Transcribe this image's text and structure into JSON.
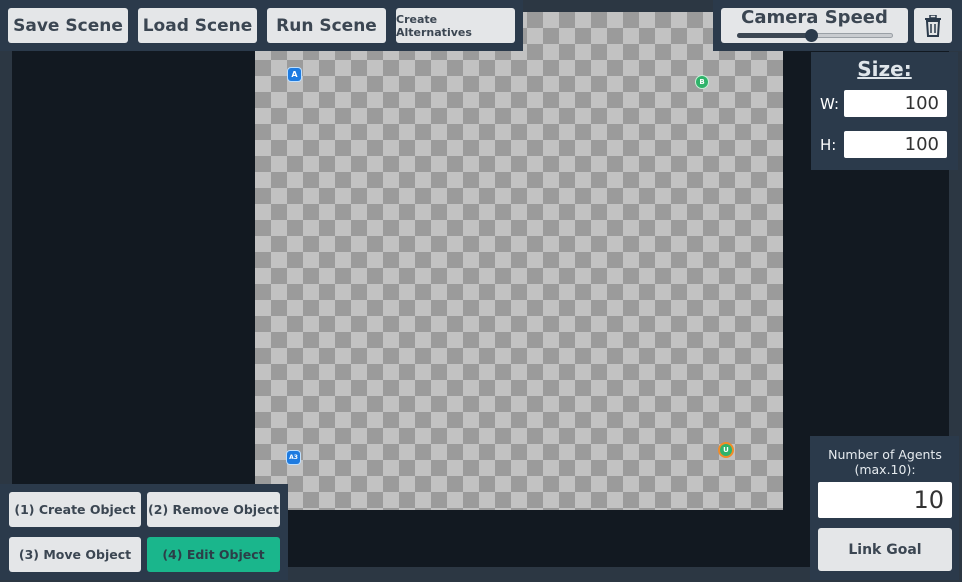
{
  "toolbar": {
    "save_label": "Save Scene",
    "load_label": "Load Scene",
    "run_label": "Run Scene",
    "alternatives_label": "Create Alternatives"
  },
  "camera": {
    "title": "Camera Speed",
    "speed_fraction": 0.48
  },
  "size_panel": {
    "title": "Size:",
    "w_label": "W:",
    "w_value": "100",
    "h_label": "H:",
    "h_value": "100"
  },
  "tools": {
    "create_label": "(1) Create Object",
    "remove_label": "(2) Remove Object",
    "move_label": "(3) Move Object",
    "edit_label": "(4) Edit Object",
    "active_tool": "edit"
  },
  "agents": {
    "label": "Number of Agents (max.10):",
    "value": "10",
    "link_goal_label": "Link Goal"
  },
  "scene_objects": {
    "agent_a_label": "A",
    "agent_b_label": "A3",
    "goal_a_label": "B",
    "goal_b_label": "U"
  },
  "colors": {
    "panel": "#2b3a4b",
    "viewport": "#121921",
    "active_button": "#1ab68c",
    "agent": "#1e7be0",
    "goal": "#2fb36a",
    "goal_ring": "#f28c28"
  },
  "icons": {
    "delete": "trash-icon"
  }
}
